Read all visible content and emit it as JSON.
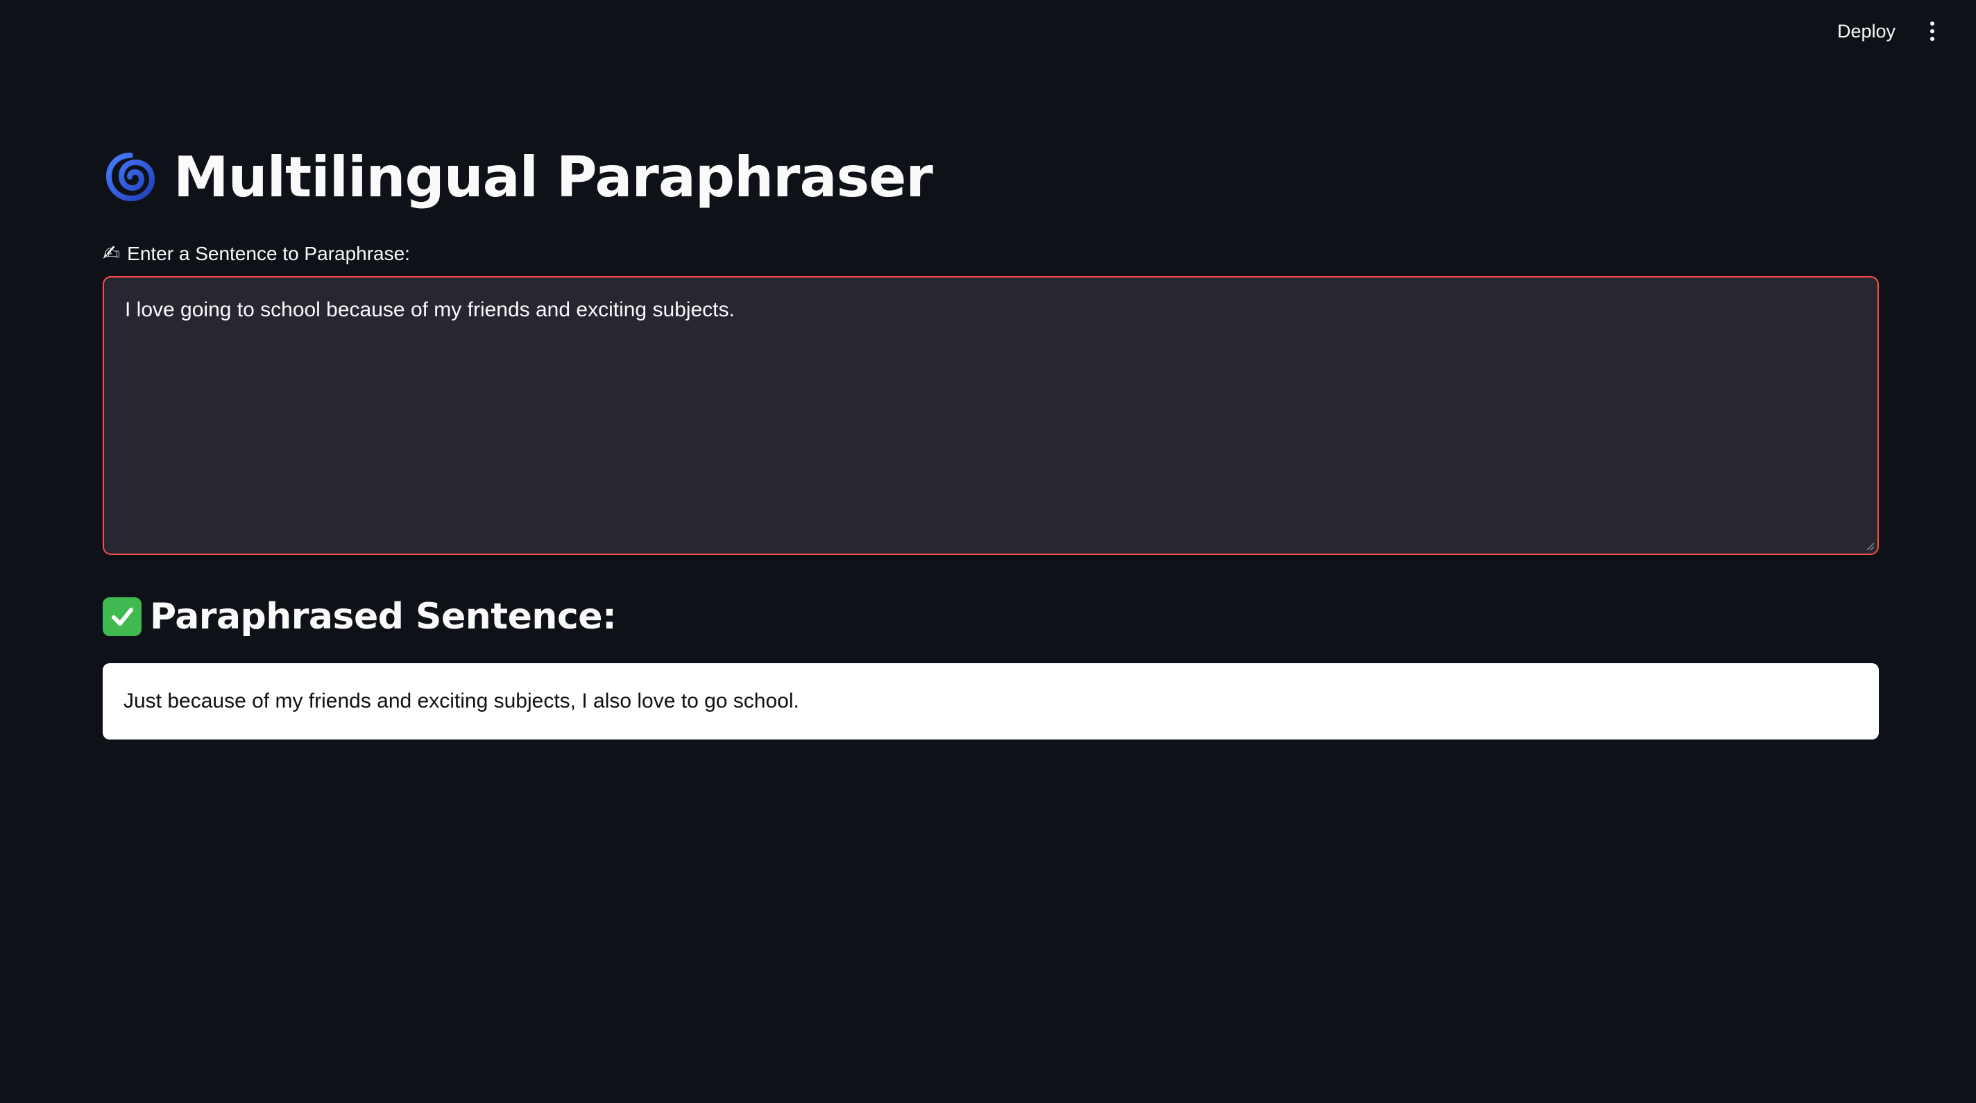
{
  "header": {
    "deploy_label": "Deploy",
    "menu_icon": "more-vert-icon"
  },
  "title": {
    "icon": "cyclone-icon",
    "text": "Multilingual Paraphraser"
  },
  "input": {
    "label_icon": "✍",
    "label": "Enter a Sentence to Paraphrase:",
    "value": "I love going to school because of my friends and exciting subjects.",
    "focus_border_color": "#ff4b4b"
  },
  "result": {
    "icon": "check-mark-button-icon",
    "heading": "Paraphrased Sentence:",
    "text": "Just because of my friends and exciting subjects, I also love to go school."
  },
  "colors": {
    "background": "#0e1117",
    "input_background": "#262730",
    "accent": "#ff4b4b",
    "check_green": "#3fb950"
  }
}
